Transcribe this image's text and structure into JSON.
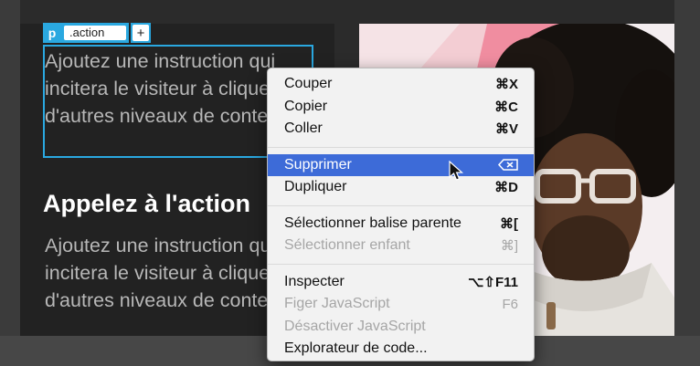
{
  "tag_toolbar": {
    "tag": "p",
    "class_value": ".action",
    "add_label": "+"
  },
  "content": {
    "paragraph_1": "Ajoutez une instruction qui incitera le visiteur à cliquer vers d'autres niveaux de contenu.",
    "heading": "Appelez à l'action",
    "paragraph_2": "Ajoutez une instruction qui incitera le visiteur à cliquer vers d'autres niveaux de contenu."
  },
  "context_menu": {
    "groups": [
      [
        {
          "label": "Couper",
          "shortcut": "⌘X",
          "enabled": true
        },
        {
          "label": "Copier",
          "shortcut": "⌘C",
          "enabled": true
        },
        {
          "label": "Coller",
          "shortcut": "⌘V",
          "enabled": true
        }
      ],
      [
        {
          "label": "Supprimer",
          "shortcut_icon": "delete-key-icon",
          "enabled": true,
          "highlighted": true
        },
        {
          "label": "Dupliquer",
          "shortcut": "⌘D",
          "enabled": true
        }
      ],
      [
        {
          "label": "Sélectionner balise parente",
          "shortcut": "⌘[",
          "enabled": true
        },
        {
          "label": "Sélectionner enfant",
          "shortcut": "⌘]",
          "enabled": false
        }
      ],
      [
        {
          "label": "Inspecter",
          "shortcut": "⌥⇧F11",
          "enabled": true
        },
        {
          "label": "Figer JavaScript",
          "shortcut": "F6",
          "enabled": false
        },
        {
          "label": "Désactiver JavaScript",
          "shortcut": "",
          "enabled": false
        },
        {
          "label": "Explorateur de code...",
          "shortcut": "",
          "enabled": true
        }
      ]
    ]
  },
  "colors": {
    "accent": "#2aa8e0",
    "highlight": "#3d6bd8",
    "canvas": "#222222"
  },
  "icons": {
    "cursor": "arrow-cursor-icon",
    "photo": "portrait-photo"
  }
}
